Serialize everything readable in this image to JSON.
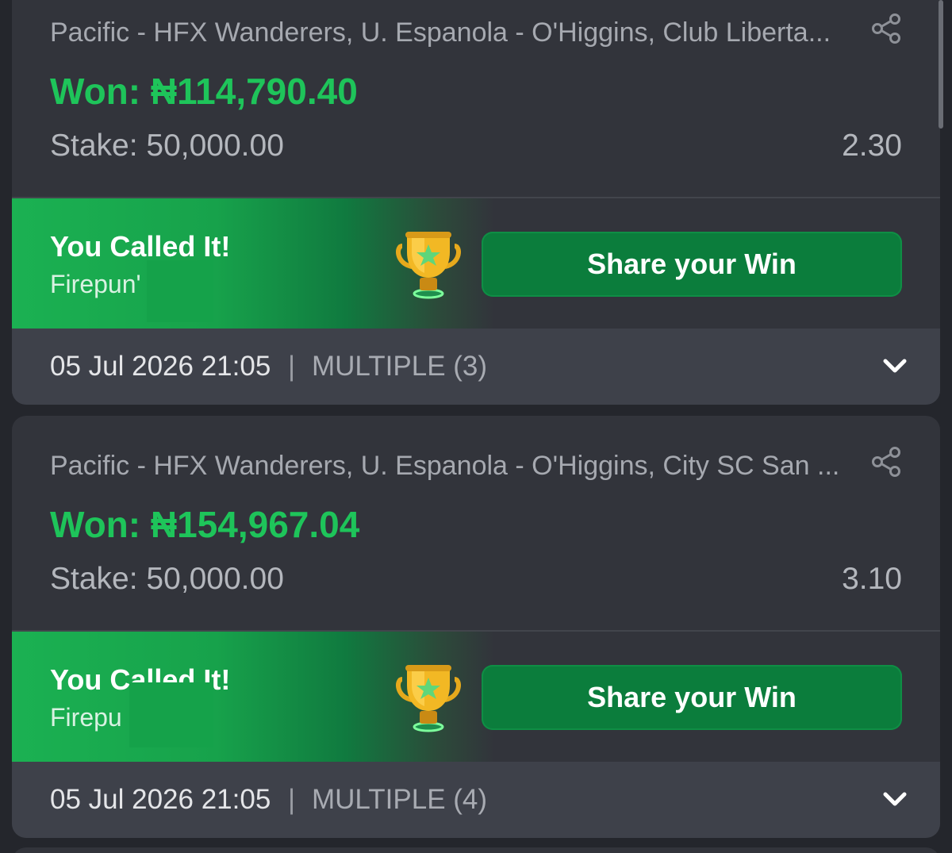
{
  "bets": [
    {
      "events": "Pacific - HFX Wanderers, U. Espanola - O'Higgins, Club Liberta...",
      "won": "Won: ₦114,790.40",
      "stake": "Stake: 50,000.00",
      "odds": "2.30",
      "banner_title": "You Called It!",
      "banner_user": "Firepun'",
      "share_label": "Share your Win",
      "date": "05 Jul 2026 21:05",
      "separator": "|",
      "bet_type": "MULTIPLE (3)"
    },
    {
      "events": "Pacific - HFX Wanderers, U. Espanola - O'Higgins, City SC San ...",
      "won": "Won: ₦154,967.04",
      "stake": "Stake: 50,000.00",
      "odds": "3.10",
      "banner_title": "You Called It!",
      "banner_user": "Firepu",
      "share_label": "Share your Win",
      "date": "05 Jul 2026 21:05",
      "separator": "|",
      "bet_type": "MULTIPLE (4)"
    }
  ],
  "icons": {
    "share": "share-icon",
    "trophy": "trophy-icon",
    "expand": "chevron-down-icon"
  },
  "colors": {
    "background": "#24262c",
    "card": "#32343b",
    "won_green": "#1ec45a",
    "button_green": "#0b7d3c",
    "banner_green": "#1bb152",
    "footer": "#3e414a"
  }
}
